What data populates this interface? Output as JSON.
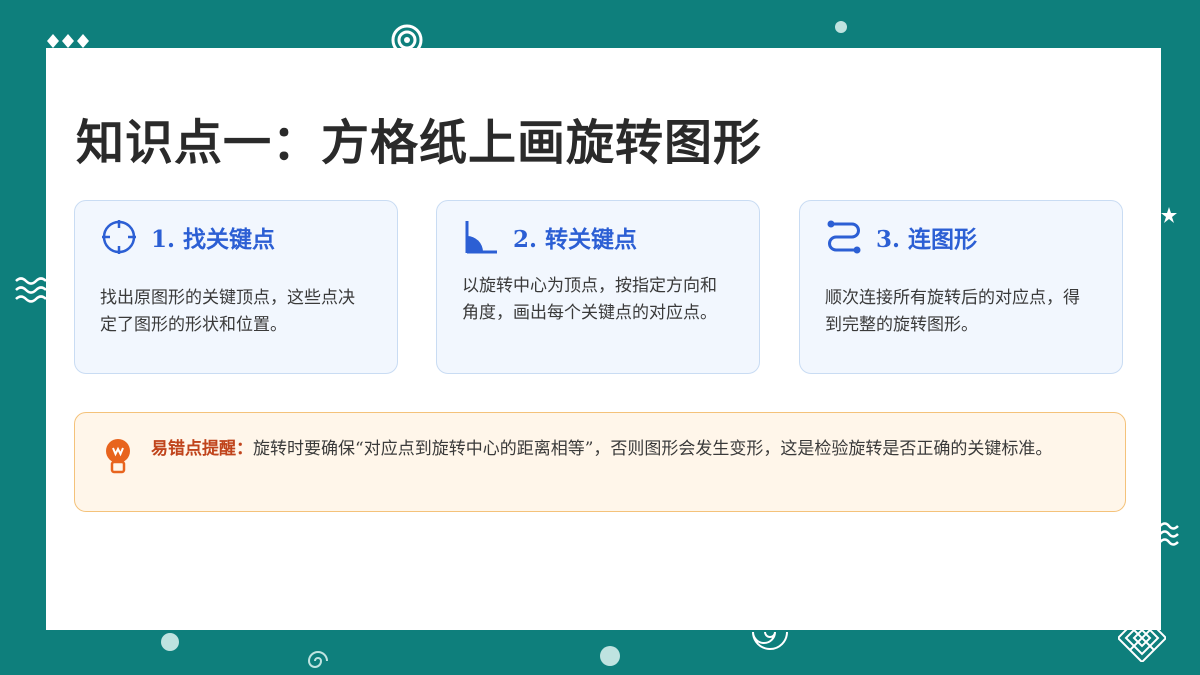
{
  "title": "知识点一：方格纸上画旋转图形",
  "steps": [
    {
      "label": "1. 找关键点",
      "icon": "crosshair-icon",
      "desc": "找出原图形的关键顶点，这些点决定了图形的形状和位置。"
    },
    {
      "label": "2. 转关键点",
      "icon": "angle-icon",
      "desc": "以旋转中心为顶点，按指定方向和角度，画出每个关键点的对应点。"
    },
    {
      "label": "3. 连图形",
      "icon": "route-icon",
      "desc": "顺次连接所有旋转后的对应点，得到完整的旋转图形。"
    }
  ],
  "tip": {
    "label": "易错点提醒：",
    "text": "旋转时要确保“对应点到旋转中心的距离相等”，否则图形会发生变形，这是检验旋转是否正确的关键标准。",
    "icon": "lightbulb-icon"
  },
  "colors": {
    "background": "#0e7f7c",
    "accent": "#2c5fd4",
    "warning": "#e8641e"
  }
}
